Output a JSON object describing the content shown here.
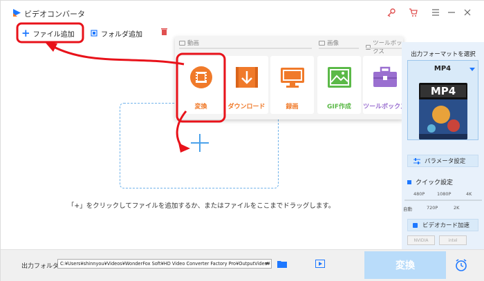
{
  "app": {
    "title": "ビデオコンバータ",
    "brand_color": "#1e78ff"
  },
  "titlebar": {
    "icons": [
      "key-icon",
      "cart-icon",
      "menu-icon",
      "minimize-icon",
      "close-icon"
    ]
  },
  "toolbar": {
    "add_file_label": "ファイル追加",
    "add_folder_label": "フォルダ追加"
  },
  "main": {
    "hint": "「+」をクリックしてファイルを追加するか、またはファイルをここまでドラッグします。"
  },
  "menu": {
    "sections": [
      {
        "label": "動画"
      },
      {
        "label": "画像"
      },
      {
        "label": "ツールボックス"
      }
    ],
    "tiles": [
      {
        "label": "変換",
        "icon": "film-convert-icon",
        "color": "#f07a2a"
      },
      {
        "label": "ダウンロード",
        "icon": "download-icon",
        "color": "#f07a2a"
      },
      {
        "label": "録画",
        "icon": "screen-record-icon",
        "color": "#f07a2a"
      },
      {
        "label": "GIF作成",
        "icon": "image-icon",
        "color": "#5bb948"
      },
      {
        "label": "ツールボックス",
        "icon": "toolbox-icon",
        "color": "#9a6fd0"
      }
    ]
  },
  "right_panel": {
    "title": "出力フォーマットを選択",
    "format": "MP4",
    "format_badge": "MP4",
    "param_label": "パラメータ設定",
    "quick_label": "クイック設定",
    "quality_top": [
      "480P",
      "1080P",
      "4K"
    ],
    "quality_bottom": [
      "自動",
      "720P",
      "2K"
    ],
    "quality_level": 0.0,
    "gpu_label": "ビデオカード加速",
    "vendors": [
      "NVIDIA",
      "intel"
    ]
  },
  "bottom": {
    "output_label": "出力フォルダ：",
    "output_path": "C:¥Users¥shinnyou¥Videos¥WonderFox Soft¥HD Video Converter Factory Pro¥OutputVideo¥",
    "convert_label": "変換"
  }
}
